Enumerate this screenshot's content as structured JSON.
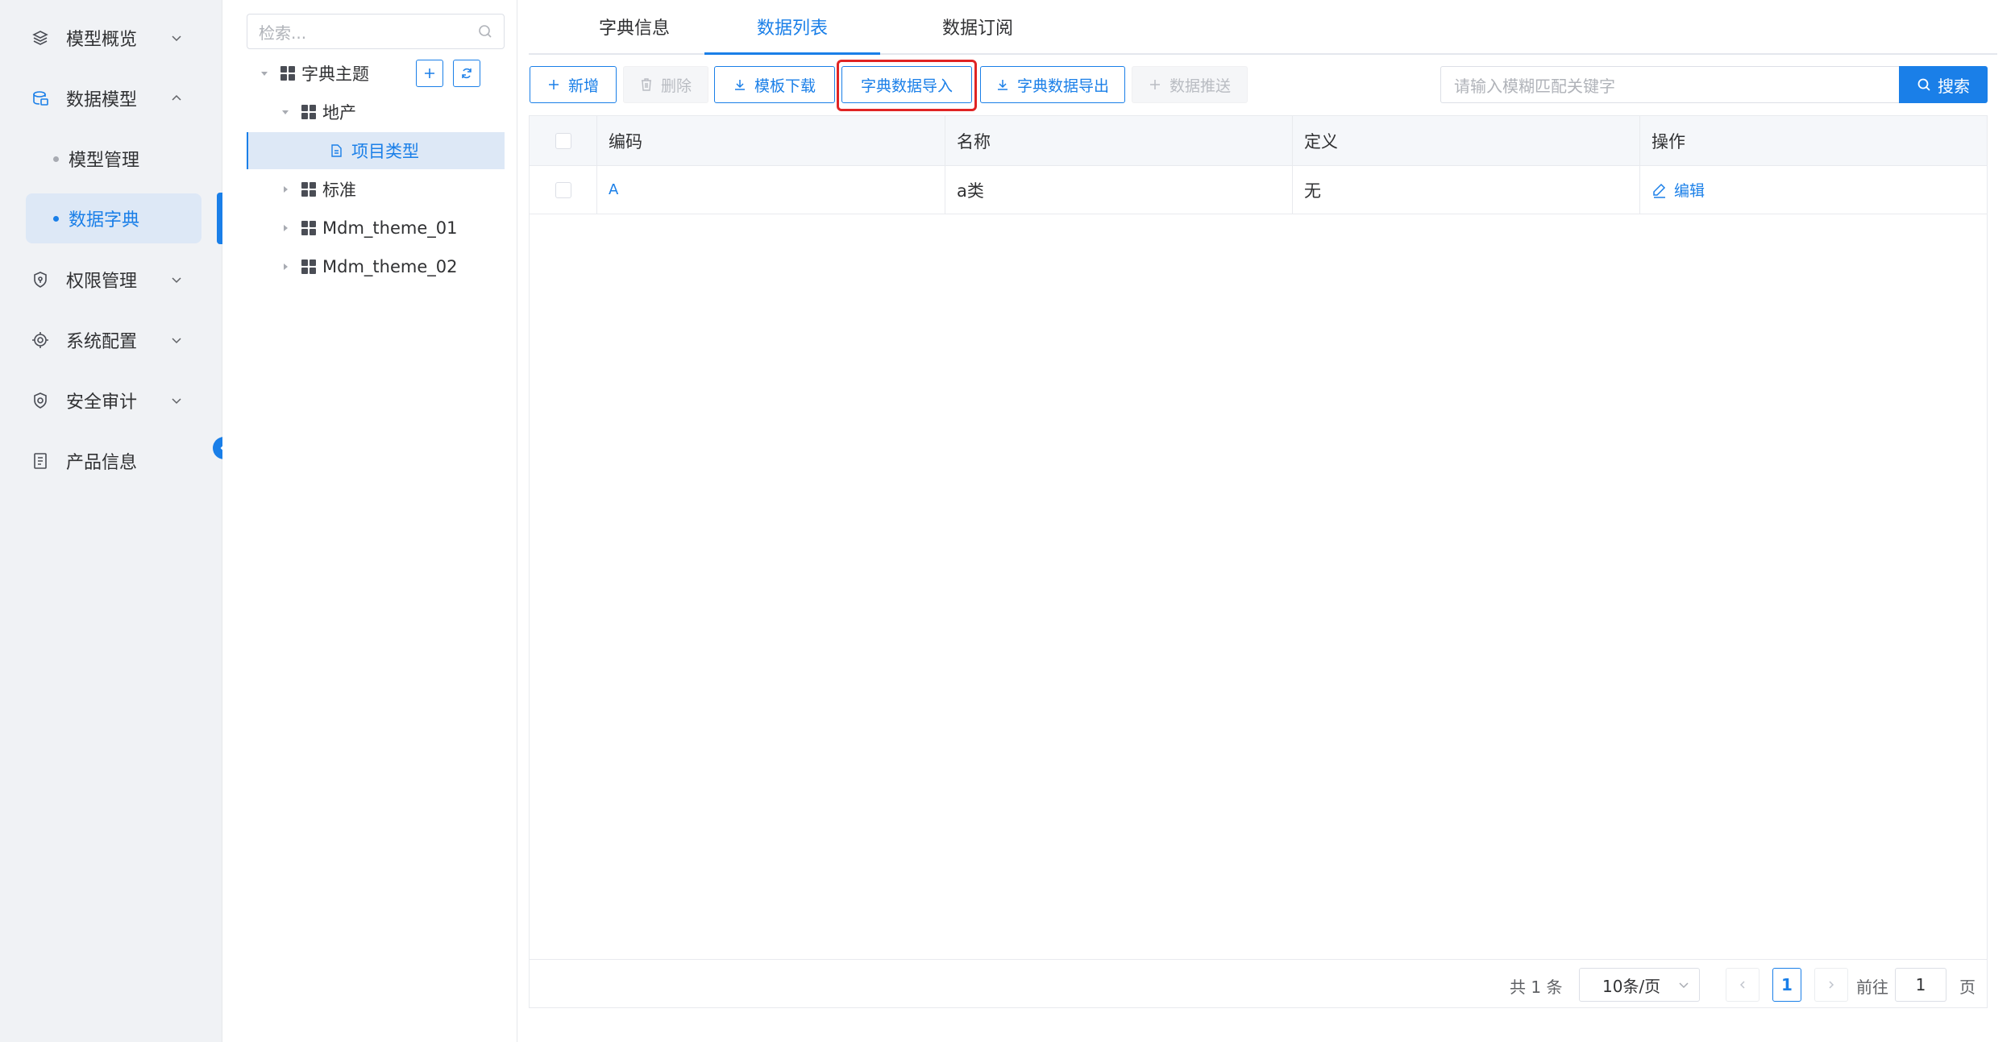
{
  "sidebar": {
    "items": [
      {
        "label": "模型概览",
        "icon": "layers-icon"
      },
      {
        "label": "数据模型",
        "icon": "database-icon"
      },
      {
        "label": "模型管理",
        "icon": "dot"
      },
      {
        "label": "数据字典",
        "icon": "dot",
        "active": true
      },
      {
        "label": "权限管理",
        "icon": "shield-icon"
      },
      {
        "label": "系统配置",
        "icon": "chip-icon"
      },
      {
        "label": "安全审计",
        "icon": "shield-check-icon"
      },
      {
        "label": "产品信息",
        "icon": "document-list-icon"
      }
    ]
  },
  "tree": {
    "search_placeholder": "检索...",
    "nodes": [
      {
        "label": "字典主题"
      },
      {
        "label": "地产"
      },
      {
        "label": "项目类型",
        "selected": true
      },
      {
        "label": "标准"
      },
      {
        "label": "Mdm_theme_01"
      },
      {
        "label": "Mdm_theme_02"
      }
    ]
  },
  "tabs": [
    {
      "label": "字典信息"
    },
    {
      "label": "数据列表",
      "active": true
    },
    {
      "label": "数据订阅"
    }
  ],
  "toolbar": {
    "add": "新增",
    "delete": "删除",
    "template_download": "模板下载",
    "import": "字典数据导入",
    "export": "字典数据导出",
    "push": "数据推送",
    "search_placeholder": "请输入模糊匹配关键字",
    "search_button": "搜索"
  },
  "table": {
    "columns": [
      "编码",
      "名称",
      "定义",
      "操作"
    ],
    "rows": [
      {
        "code": "A",
        "name": "a类",
        "definition": "无",
        "action": "编辑"
      }
    ]
  },
  "pagination": {
    "total": "共 1 条",
    "page_size": "10条/页",
    "current_page": "1",
    "goto_label": "前往",
    "goto_value": "1",
    "page_suffix": "页"
  },
  "colors": {
    "primary": "#1a7fe8",
    "highlight": "#e02424",
    "sidebar_bg": "#f0f2f5"
  }
}
